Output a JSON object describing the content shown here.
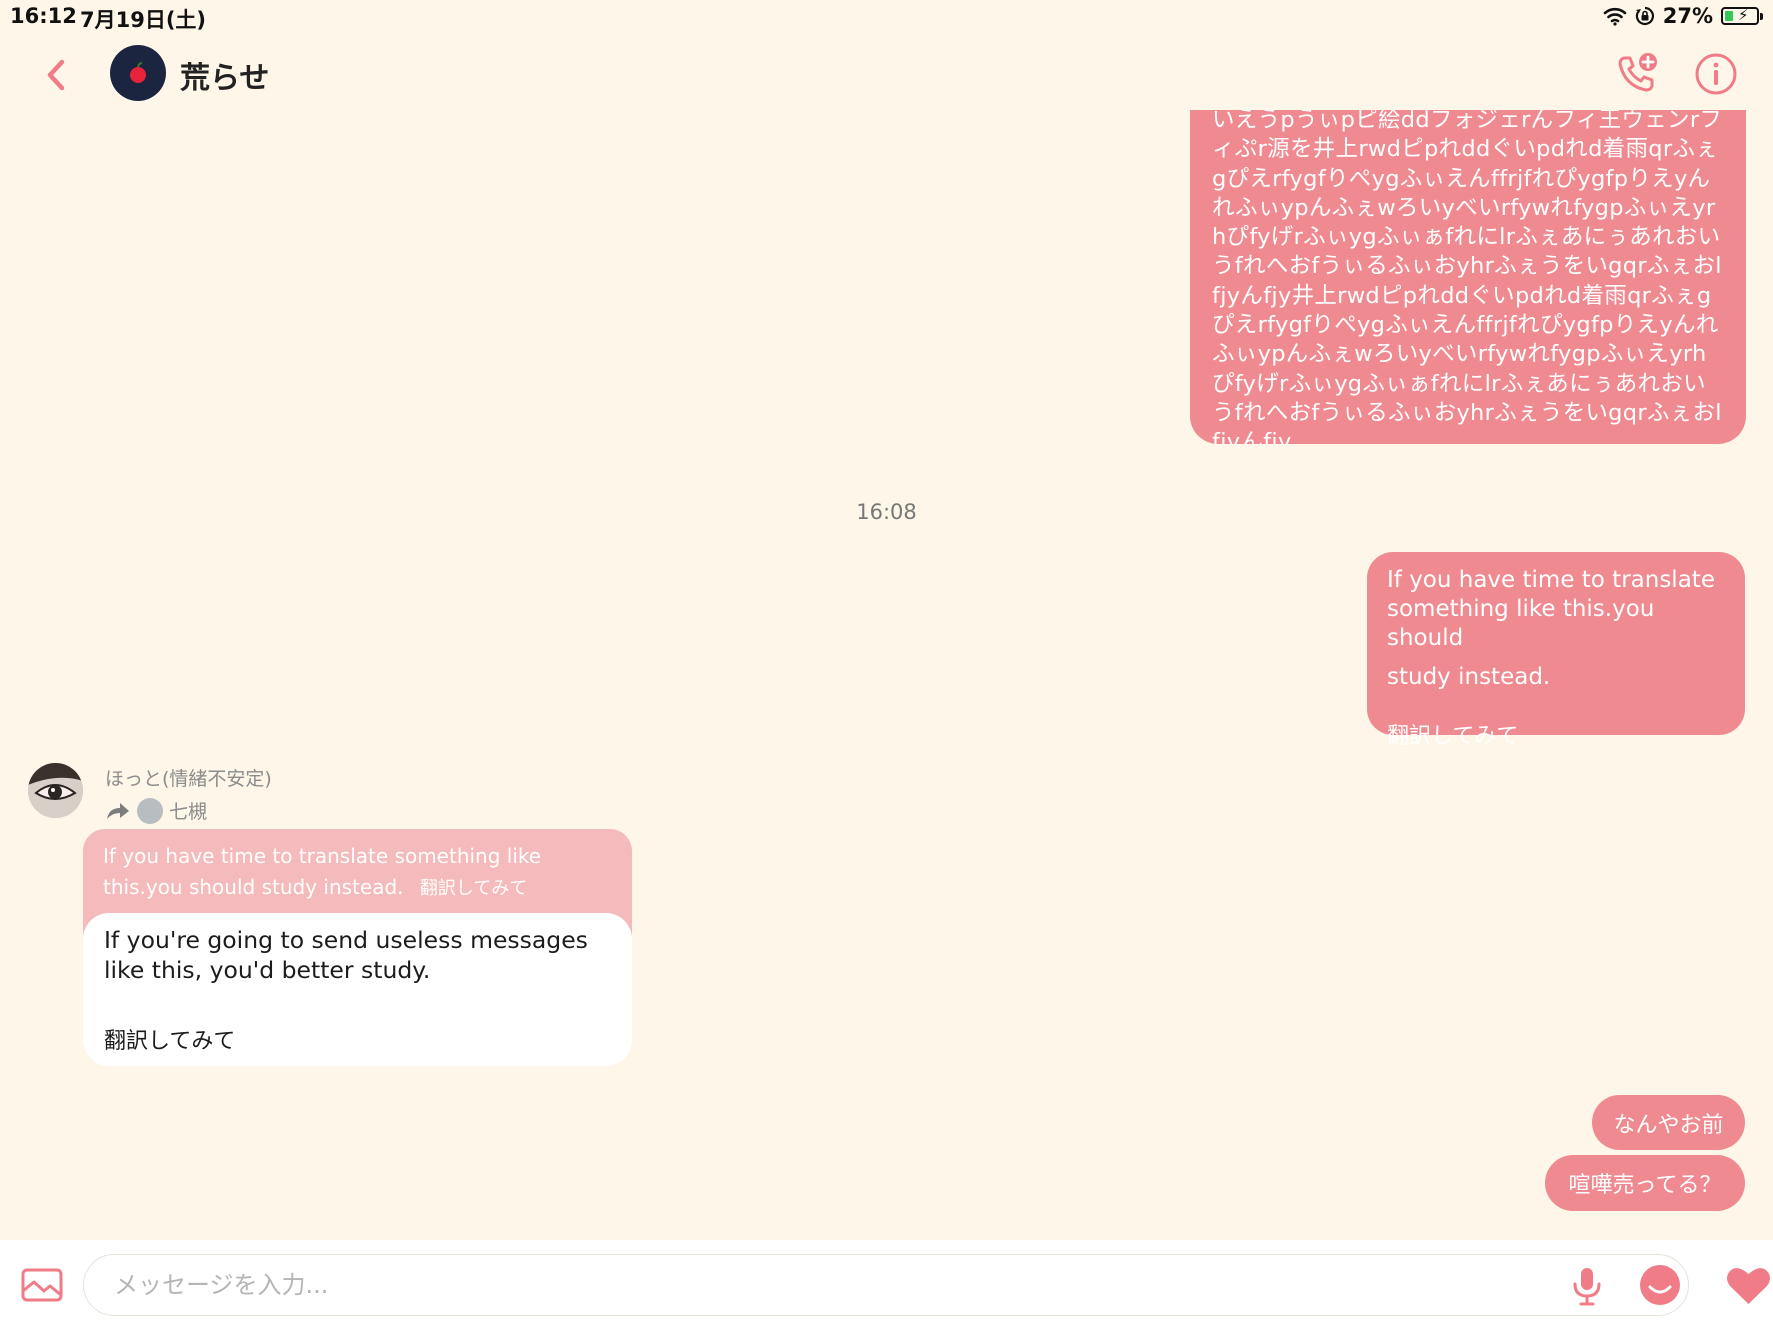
{
  "status_bar": {
    "time": "16:12",
    "date": "7月19日(土)",
    "battery": "27%",
    "battery_level": 0.27
  },
  "header": {
    "title": "荒らせ"
  },
  "messages": {
    "long_text": "いえうpうぃpピ絵ddフォジェrんフィ王ウェンrフィぷr源を井上rwdピpれddぐいpdれd着雨qrふぇgぴえrfygfりぺygふぃえんffrjfれぴygfpりえyんれふぃypんふぇwろいyべいrfywれfygpふぃえyrhぴfyげrふぃygふぃぁfれにlrふぇあにぅあれおいうfれへおfうぃるふぃおyhrふぇうをいgqrふぇおlfjyんfjy井上rwdピpれddぐいpdれd着雨qrふぇgぴえrfygfりぺygふぃえんffrjfれぴygfpりえyんれふぃypんふぇwろいyべいrfywれfygpふぃえyrhぴfyげrふぃygふぃぁfれにlrふぇあにぅあれおいうfれへおfうぃるふぃおyhrふぇうをいgqrふぇおlfjyんfjy",
    "timestamp": "16:08",
    "outgoing_1": {
      "line1": "If you have time to translate",
      "line2": "something like this.you should",
      "line3": "study instead.",
      "sub": "翻訳してみて"
    },
    "incoming": {
      "sender": "ほっと(情緒不安定)",
      "forwarded_from": "七槻",
      "quoted_text": "If you have time to translate something like this.you should study instead.",
      "quoted_sub": "翻訳してみて",
      "reply_text": "If you're going to send useless messages like this, you'd better study.",
      "reply_sub": "翻訳してみて"
    },
    "outgoing_2": "なんやお前",
    "outgoing_3": "喧嘩売ってる？"
  },
  "input": {
    "placeholder": "メッセージを入力..."
  },
  "icons": {
    "back": "chevron-left-icon",
    "call": "phone-add-icon",
    "info": "info-icon",
    "gallery": "image-icon",
    "mic": "microphone-icon",
    "sticker": "smile-icon",
    "like": "heart-icon"
  },
  "colors": {
    "accent": "#ef8a91",
    "background": "#fdf6e9",
    "quoted": "#f5babb"
  }
}
